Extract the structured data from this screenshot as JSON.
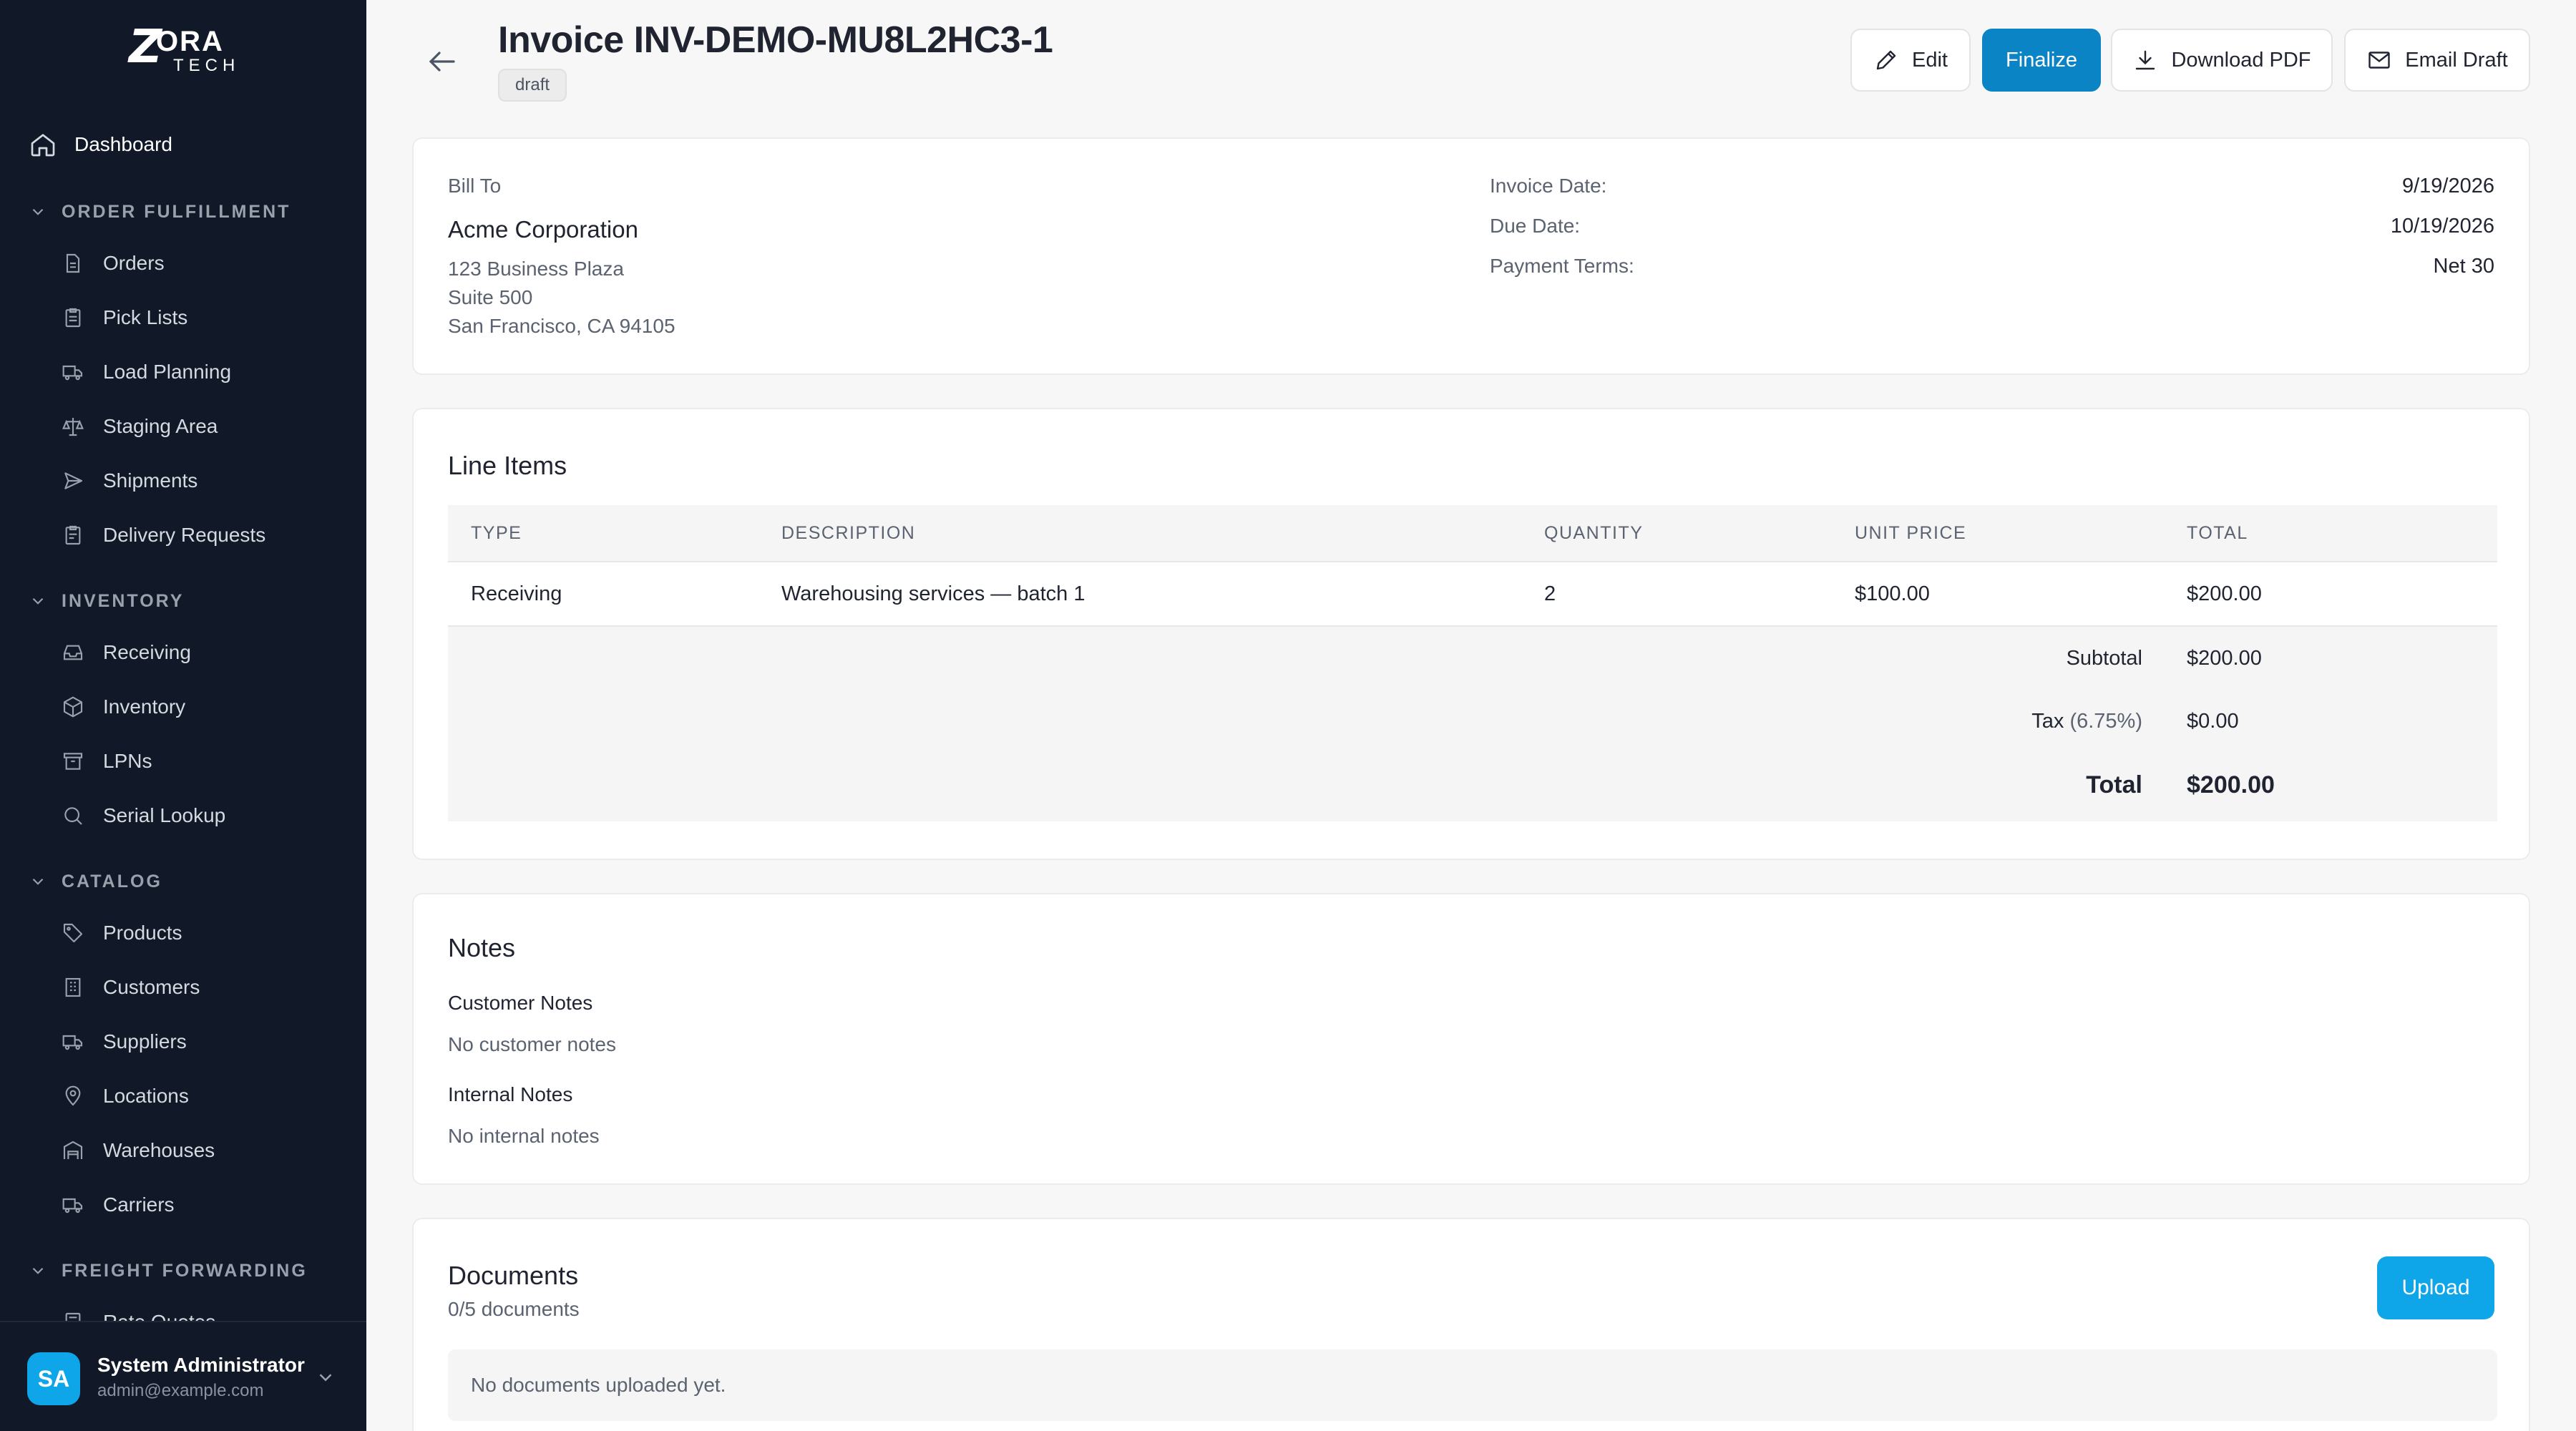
{
  "brand": {
    "z": "Z",
    "ora": "ORA",
    "tech": "TECH"
  },
  "sidebar": {
    "dashboard": "Dashboard",
    "sections": [
      {
        "label": "ORDER FULFILLMENT",
        "items": [
          "Orders",
          "Pick Lists",
          "Load Planning",
          "Staging Area",
          "Shipments",
          "Delivery Requests"
        ]
      },
      {
        "label": "INVENTORY",
        "items": [
          "Receiving",
          "Inventory",
          "LPNs",
          "Serial Lookup"
        ]
      },
      {
        "label": "CATALOG",
        "items": [
          "Products",
          "Customers",
          "Suppliers",
          "Locations",
          "Warehouses",
          "Carriers"
        ]
      },
      {
        "label": "FREIGHT FORWARDING",
        "items": [
          "Rate Quotes"
        ]
      }
    ]
  },
  "user": {
    "initials": "SA",
    "name": "System Administrator",
    "email": "admin@example.com"
  },
  "header": {
    "title": "Invoice INV-DEMO-MU8L2HC3-1",
    "status": "draft",
    "buttons": {
      "edit": "Edit",
      "finalize": "Finalize",
      "download": "Download PDF",
      "email": "Email Draft"
    }
  },
  "bill_to": {
    "label": "Bill To",
    "company": "Acme Corporation",
    "address": [
      "123 Business Plaza",
      "Suite 500",
      "San Francisco, CA 94105"
    ]
  },
  "invoice_meta": {
    "invoice_date_label": "Invoice Date:",
    "invoice_date": "9/19/2026",
    "due_date_label": "Due Date:",
    "due_date": "10/19/2026",
    "terms_label": "Payment Terms:",
    "terms": "Net 30"
  },
  "line_items": {
    "title": "Line Items",
    "columns": [
      "TYPE",
      "DESCRIPTION",
      "QUANTITY",
      "UNIT PRICE",
      "TOTAL"
    ],
    "rows": [
      {
        "type": "Receiving",
        "description": "Warehousing services — batch 1",
        "quantity": "2",
        "unit_price": "$100.00",
        "total": "$200.00"
      }
    ],
    "subtotal_label": "Subtotal",
    "subtotal": "$200.00",
    "tax_label": "Tax",
    "tax_rate": "(6.75%)",
    "tax": "$0.00",
    "total_label": "Total",
    "total": "$200.00"
  },
  "notes": {
    "title": "Notes",
    "customer_label": "Customer Notes",
    "customer_value": "No customer notes",
    "internal_label": "Internal Notes",
    "internal_value": "No internal notes"
  },
  "documents": {
    "title": "Documents",
    "count": "0/5 documents",
    "upload": "Upload",
    "empty": "No documents uploaded yet."
  }
}
